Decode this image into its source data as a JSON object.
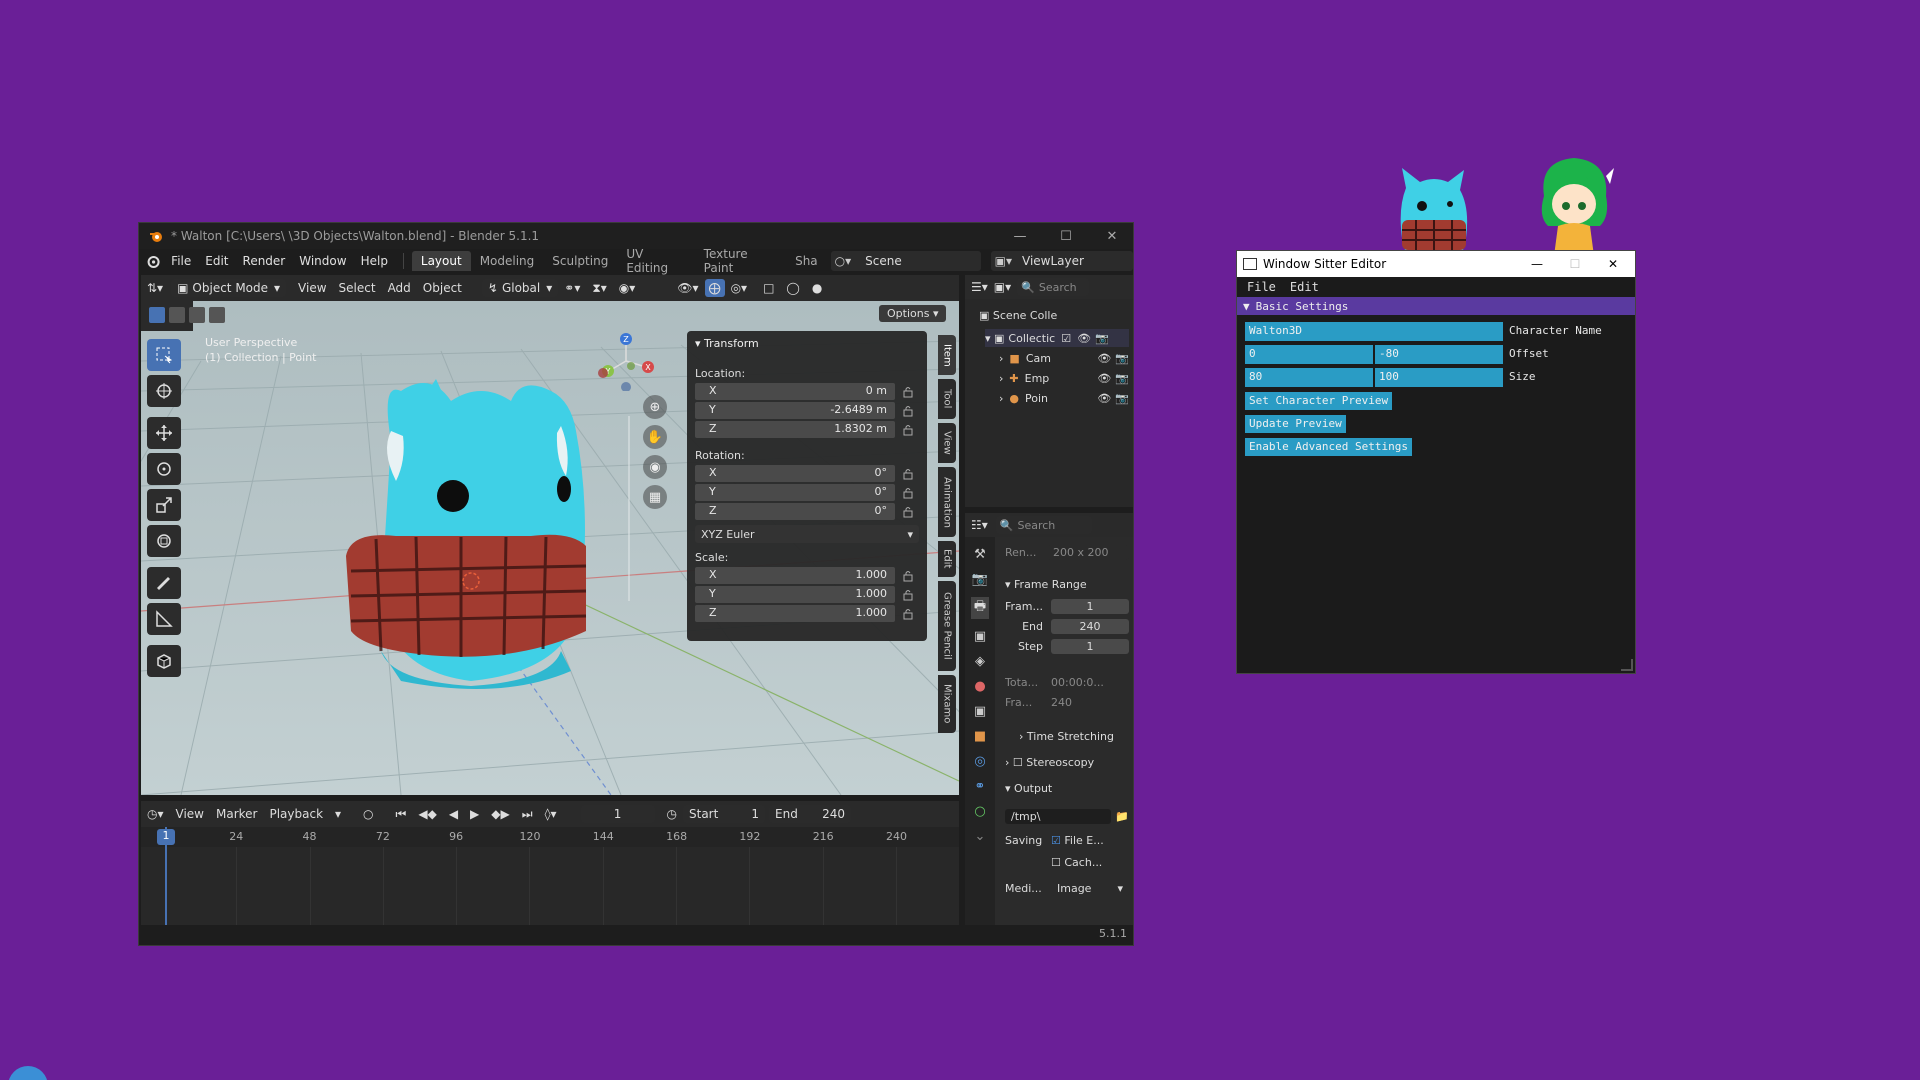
{
  "blender": {
    "title": "* Walton [C:\\Users\\        \\3D Objects\\Walton.blend] - Blender 5.1.1",
    "menu": [
      "File",
      "Edit",
      "Render",
      "Window",
      "Help"
    ],
    "workspaces": [
      "Layout",
      "Modeling",
      "Sculpting",
      "UV Editing",
      "Texture Paint",
      "Sha"
    ],
    "active_workspace": "Layout",
    "scene": "Scene",
    "view_layer": "ViewLayer",
    "viewport": {
      "mode": "Object Mode",
      "menus": [
        "View",
        "Select",
        "Add",
        "Object"
      ],
      "orientation": "Global",
      "options_label": "Options",
      "overlay_title": "User Perspective",
      "overlay_sub": "(1) Collection | Point"
    },
    "transform": {
      "title": "Transform",
      "location_label": "Location:",
      "location": [
        {
          "axis": "X",
          "value": "0 m"
        },
        {
          "axis": "Y",
          "value": "-2.6489 m"
        },
        {
          "axis": "Z",
          "value": "1.8302 m"
        }
      ],
      "rotation_label": "Rotation:",
      "rotation": [
        {
          "axis": "X",
          "value": "0°"
        },
        {
          "axis": "Y",
          "value": "0°"
        },
        {
          "axis": "Z",
          "value": "0°"
        }
      ],
      "rotation_mode": "XYZ Euler",
      "scale_label": "Scale:",
      "scale": [
        {
          "axis": "X",
          "value": "1.000"
        },
        {
          "axis": "Y",
          "value": "1.000"
        },
        {
          "axis": "Z",
          "value": "1.000"
        }
      ]
    },
    "side_tabs": [
      "Item",
      "Tool",
      "View",
      "Animation",
      "Edit",
      "Grease Pencil",
      "Mixamo"
    ],
    "timeline": {
      "menus": [
        "View",
        "Marker",
        "Playback"
      ],
      "current_frame": "1",
      "start_label": "Start",
      "start": "1",
      "end_label": "End",
      "end": "240",
      "ticks": [
        "1",
        "24",
        "48",
        "72",
        "96",
        "120",
        "144",
        "168",
        "192",
        "216",
        "240"
      ]
    },
    "outliner": {
      "search_placeholder": "Search",
      "root": "Scene Colle",
      "collection": "Collectic",
      "items": [
        "Cam",
        "Emp",
        "Poin"
      ]
    },
    "properties": {
      "search_placeholder": "Search",
      "render_res_label": "Ren...",
      "render_res": "200 x 200",
      "frame_range_title": "Frame Range",
      "frame_start_label": "Fram...",
      "frame_start": "1",
      "frame_end_label": "End",
      "frame_end": "240",
      "frame_step_label": "Step",
      "frame_step": "1",
      "total_label": "Tota...",
      "total": "00:00:0...",
      "fra_label": "Fra...",
      "fra": "240",
      "time_stretching": "Time Stretching",
      "stereoscopy": "Stereoscopy",
      "output_title": "Output",
      "output_path": "/tmp\\",
      "saving_label": "Saving",
      "file_ext": "File E...",
      "cache": "Cach...",
      "media_label": "Medi...",
      "media": "Image"
    },
    "version": "5.1.1"
  },
  "sitter": {
    "title": "Window Sitter Editor",
    "menu": [
      "File",
      "Edit"
    ],
    "section": "Basic Settings",
    "character_name": "Walton3D",
    "character_name_label": "Character Name",
    "offset_x": "0",
    "offset_y": "-80",
    "offset_label": "Offset",
    "size_w": "80",
    "size_h": "100",
    "size_label": "Size",
    "btn_set_preview": "Set Character Preview",
    "btn_update_preview": "Update Preview",
    "btn_advanced": "Enable Advanced Settings"
  },
  "colors": {
    "desktop": "#6a1f97",
    "sitter_accent": "#2a9cc5",
    "blender_active": "#4772b3",
    "character_body": "#3fd0e6",
    "scarf": "#a23b30"
  }
}
